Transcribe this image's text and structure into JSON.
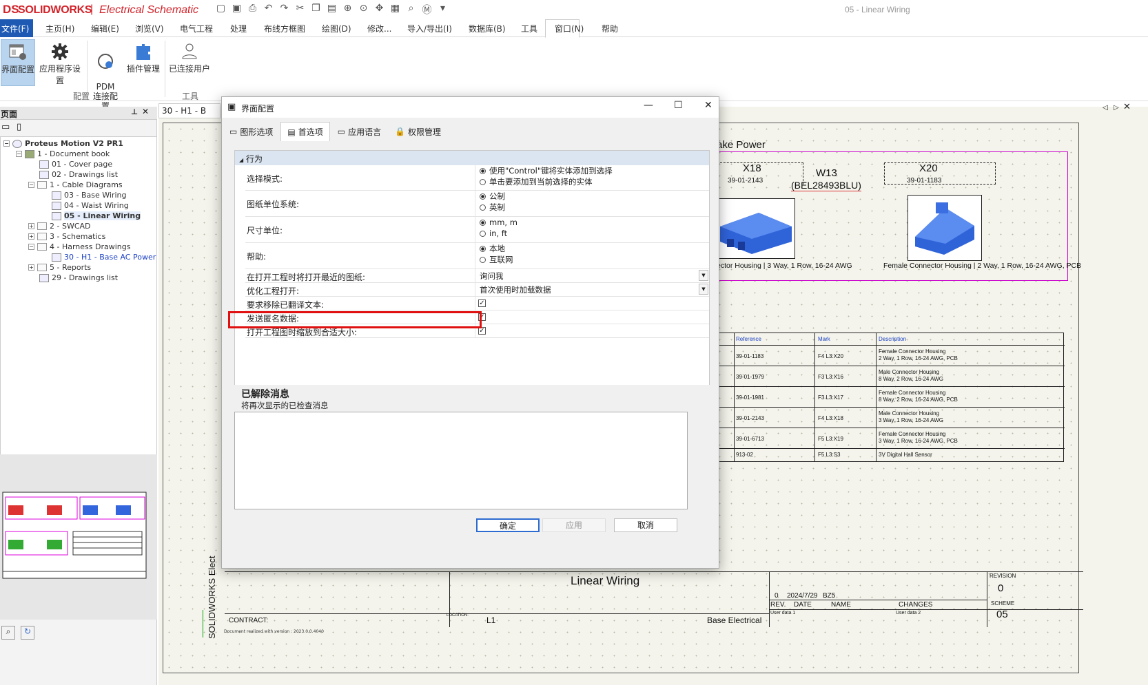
{
  "app": {
    "brand_ds": "DS",
    "brand_sw": "SOLIDWORKS",
    "brand_sep": "|",
    "brand_module": "Electrical Schematic",
    "doc_title": "05 - Linear Wiring"
  },
  "menu": {
    "file": "文件(F)",
    "items": [
      "主页(H)",
      "编辑(E)",
      "浏览(V)",
      "电气工程",
      "处理",
      "布线方框图",
      "绘图(D)",
      "修改...",
      "导入/导出(I)",
      "数据库(B)",
      "工具",
      "窗口(N)",
      "帮助"
    ]
  },
  "ribbon": {
    "buttons": [
      {
        "label": "界面配置"
      },
      {
        "label": "应用程序设置"
      },
      {
        "label": "PDM\n连接配置"
      },
      {
        "label": "插件管理"
      },
      {
        "label": "已连接用户"
      }
    ],
    "group_config": "配置",
    "group_tools": "工具"
  },
  "left": {
    "pane_title": "页面",
    "doc_tab": "30 - H1 - B",
    "tree": [
      {
        "label": "Proteus Motion V2 PR1"
      },
      {
        "label": "1 - Document book"
      },
      {
        "label": "01 - Cover page"
      },
      {
        "label": "02 - Drawings list"
      },
      {
        "label": "1 - Cable Diagrams"
      },
      {
        "label": "03 - Base Wiring"
      },
      {
        "label": "04 - Waist Wiring"
      },
      {
        "label": "05 - Linear Wiring"
      },
      {
        "label": "2 - SWCAD"
      },
      {
        "label": "3 - Schematics"
      },
      {
        "label": "4 - Harness Drawings"
      },
      {
        "label": "30 - H1 - Base AC Power"
      },
      {
        "label": "5 - Reports"
      },
      {
        "label": "29 - Drawings list"
      }
    ]
  },
  "drawing": {
    "header": "ake Power",
    "x18": "X18",
    "x18_part": "39-01-2143",
    "w13": "W13",
    "w13_part": "(BEL28493BLU)",
    "x20": "X20",
    "x20_part": "39-01-1183",
    "cap_left": "ector Housing | 3 Way, 1 Row, 16-24 AWG",
    "cap_right": "Female Connector Housing | 2 Way, 1 Row, 16-24 AWG, PCB",
    "bom_headers": [
      "Reference",
      "Mark",
      "Description"
    ],
    "bom_rows": [
      [
        "39-01-1183",
        "F4  L3:X20",
        "Female Connector Housing\n2 Way, 1 Row, 16-24 AWG, PCB"
      ],
      [
        "39-01-1979",
        "F3  L3:X16",
        "Male Connector Housing\n8 Way, 2 Row, 16-24 AWG"
      ],
      [
        "39-01-1981",
        "F3  L3:X17",
        "Female Connector Housing\n8 Way, 2 Row, 16-24 AWG, PCB"
      ],
      [
        "39-01-2143",
        "F4  L3:X18",
        "Male Connector Housing\n3 Way, 1 Row, 16-24 AWG"
      ],
      [
        "39-01-6713",
        "F5  L3:X19",
        "Female Connector Housing\n3 Way, 1 Row, 16-24 AWG, PCB"
      ],
      [
        "913-02",
        "F5  L3:S3",
        "3V Digital Hall Sensor"
      ]
    ],
    "tb_title": "Linear Wiring",
    "tb_contract": "CONTRACT:",
    "tb_location": "LOCATION:",
    "tb_loc_val": "L1",
    "tb_base": "Base Electrical",
    "tb_rev": "REV.",
    "tb_date": "DATE",
    "tb_name": "NAME",
    "tb_changes": "CHANGES",
    "tb_rev_val": "0",
    "tb_date_val": "2024/7/29",
    "tb_name_val": "BZ5",
    "tb_revision": "REVISION",
    "tb_revision_val": "0",
    "tb_scheme": "SCHEME",
    "tb_scheme_val": "05",
    "tb_userdata1": "User data 1",
    "tb_userdata2": "User data 2",
    "side_text": "SOLIDWORKS Elect",
    "footer": "Document realized with version : 2023.0.0.4040"
  },
  "dialog": {
    "title": "界面配置",
    "tabs": [
      "图形选项",
      "首选项",
      "应用语言",
      "权限管理"
    ],
    "section": "行为",
    "rows": [
      {
        "label": "选择模式:",
        "options": [
          "使用\"Control\"键将实体添加到选择",
          "单击要添加到当前选择的实体"
        ]
      },
      {
        "label": "图纸单位系统:",
        "options": [
          "公制",
          "英制"
        ]
      },
      {
        "label": "尺寸单位:",
        "options": [
          "mm, m",
          "in, ft"
        ]
      },
      {
        "label": "帮助:",
        "options": [
          "本地",
          "互联网"
        ]
      },
      {
        "label": "在打开工程时将打开最近的图纸:",
        "value": "询问我"
      },
      {
        "label": "优化工程打开:",
        "value": "首次使用时加载数据"
      },
      {
        "label": "要求移除已翻译文本:"
      },
      {
        "label": "发送匿名数据:"
      },
      {
        "label": "打开工程图时缩放到合适大小:"
      }
    ],
    "msg_title": "已解除消息",
    "msg_sub": "将再次显示的已检查消息",
    "ok": "确定",
    "apply": "应用",
    "cancel": "取消",
    "check": "✓"
  }
}
